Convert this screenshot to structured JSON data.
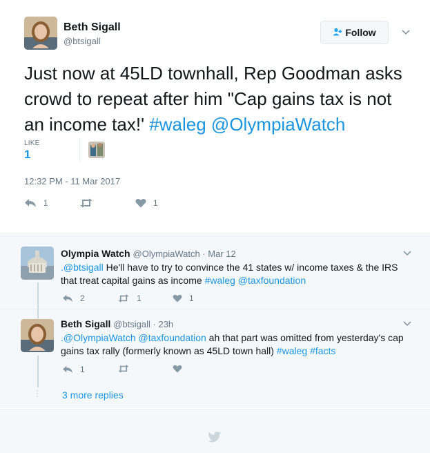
{
  "main_tweet": {
    "name": "Beth Sigall",
    "handle": "@btsigall",
    "follow_label": "Follow",
    "text_plain": "Just now at 45LD townhall, Rep Goodman asks crowd to repeat after him \"Cap gains tax is not an income tax!' ",
    "hashtag": "#waleg",
    "mention": "@OlympiaWatch",
    "likes_label": "LIKE",
    "likes_count": "1",
    "timestamp": "12:32 PM - 11 Mar 2017",
    "reply_count": "1",
    "retweet_count": "",
    "like_count": "1"
  },
  "replies": [
    {
      "name": "Olympia Watch",
      "meta": "@OlympiaWatch · Mar 12",
      "text_mention": ".@btsigall",
      "text_body": " He'll have to try to convince the 41 states w/ income taxes & the IRS that treat capital gains as income  ",
      "text_tag1": "#waleg",
      "text_tag2": "@taxfoundation",
      "reply_count": "2",
      "retweet_count": "1",
      "like_count": "1"
    },
    {
      "name": "Beth Sigall",
      "meta": "@btsigall · 23h",
      "text_mention1": ".@OlympiaWatch",
      "text_mention2": "@taxfoundation",
      "text_body": " ah that part was omitted from yesterday's cap gains tax rally (formerly known as 45LD town hall) ",
      "text_tag1": "#waleg",
      "text_tag2": "#facts",
      "reply_count": "1",
      "retweet_count": "",
      "like_count": ""
    }
  ],
  "more_replies_label": "3 more replies",
  "colors": {
    "link": "#1b95e0",
    "muted": "#657786",
    "bg_thread": "#f5f8fa",
    "border": "#e6ecf0"
  },
  "icons": [
    "follow-person-icon",
    "chevron-down-icon",
    "reply-icon",
    "retweet-icon",
    "like-heart-icon",
    "twitter-bird-icon"
  ]
}
